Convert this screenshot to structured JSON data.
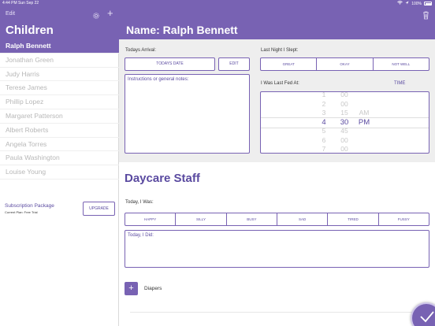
{
  "status_bar": {
    "time": "4:44 PM",
    "date": "Sun Sep 22",
    "battery": "100%"
  },
  "sidebar": {
    "edit_label": "Edit",
    "title": "Children",
    "children": [
      "Ralph Bennett",
      "Jonathan Green",
      "Judy Harris",
      "Terese James",
      "Phillip Lopez",
      "Margaret Patterson",
      "Albert Roberts",
      "Angela Torres",
      "Paula Washington",
      "Louise Young"
    ],
    "selected_index": 0,
    "subscription_label": "Subscription Package",
    "current_plan": "Current Plan: Free Trial",
    "upgrade_label": "UPGRADE"
  },
  "header": {
    "name_title": "Name: Ralph Bennett"
  },
  "arrival": {
    "label": "Todays Arrival:",
    "todays_date_label": "TODAYS DATE",
    "edit_label": "EDIT",
    "notes_placeholder": "Instructions or general notes:"
  },
  "sleep": {
    "label": "Last Night I Slept:",
    "options": [
      "GREAT",
      "OKAY",
      "NOT WELL"
    ]
  },
  "fed": {
    "label": "I Was Last Fed At:",
    "time_label": "TIME",
    "picker": {
      "hours": [
        "1",
        "2",
        "3",
        "4",
        "5",
        "6",
        "7"
      ],
      "minutes": [
        "00",
        "00",
        "15",
        "30",
        "45",
        "00",
        "00"
      ],
      "periods": [
        "",
        "",
        "AM",
        "PM",
        "",
        "",
        ""
      ],
      "selected_row": 3
    }
  },
  "staff": {
    "title": "Daycare Staff",
    "today_was_label": "Today, I Was:",
    "moods": [
      "HAPPY",
      "SILLY",
      "BUSY",
      "SAD",
      "TIRED",
      "FUSSY"
    ],
    "today_did_placeholder": "Today, I Did:",
    "diapers_label": "Diapers"
  },
  "colors": {
    "accent": "#7862b3",
    "accent_dark": "#5a4aa0",
    "panel_bg": "#eeeeee"
  }
}
